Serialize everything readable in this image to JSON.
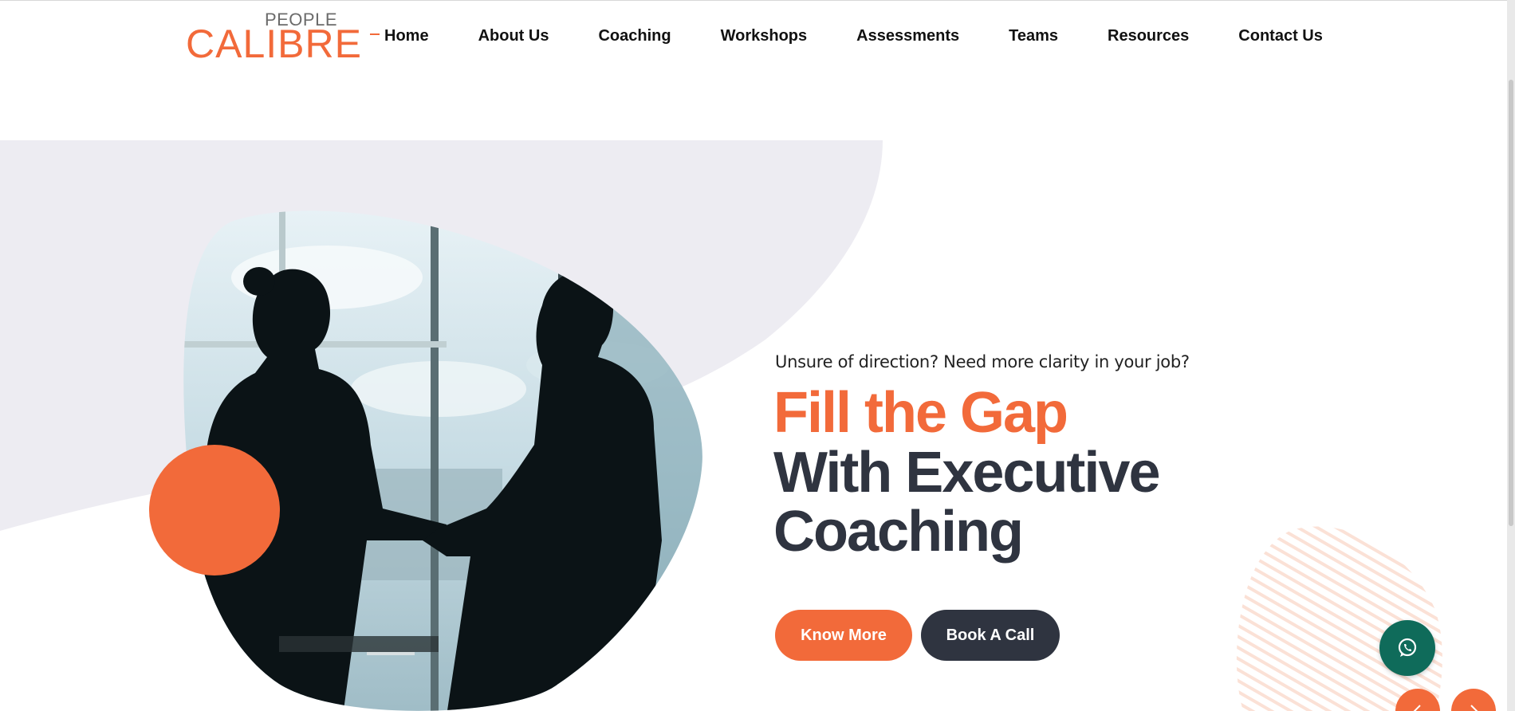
{
  "brand": {
    "logo_small": "PEOPLE",
    "logo_large": "CALIBRE",
    "accent_color": "#f26a3a",
    "dark_color": "#2f3440"
  },
  "nav": {
    "items": [
      {
        "label": "Home",
        "active": true
      },
      {
        "label": "About Us",
        "active": false
      },
      {
        "label": "Coaching",
        "active": false
      },
      {
        "label": "Workshops",
        "active": false
      },
      {
        "label": "Assessments",
        "active": false
      },
      {
        "label": "Teams",
        "active": false
      },
      {
        "label": "Resources",
        "active": false
      },
      {
        "label": "Contact Us",
        "active": false
      }
    ]
  },
  "hero": {
    "subtitle": "Unsure of direction? Need more clarity in your job?",
    "headline_line1": "Fill the Gap",
    "headline_line2": "With Executive",
    "headline_line3": "Coaching",
    "primary_button": "Know More",
    "secondary_button": "Book A Call",
    "image": "handshake-silhouette-photo"
  },
  "floating": {
    "whatsapp_icon": "whatsapp-icon",
    "prev_icon": "chevron-left-icon",
    "next_icon": "chevron-right-icon",
    "whatsapp_color": "#0f6b5a"
  }
}
